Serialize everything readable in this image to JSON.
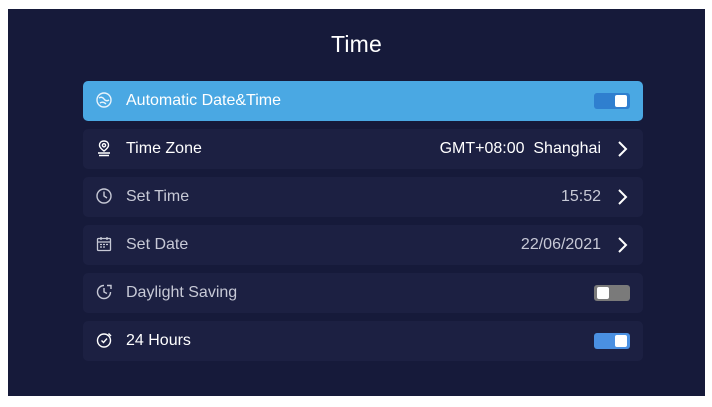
{
  "page": {
    "title": "Time"
  },
  "settings": [
    {
      "label": "Automatic Date&Time",
      "icon": "globe-clock-icon",
      "control": "toggle",
      "state": "on",
      "selected": true
    },
    {
      "label": "Time Zone",
      "icon": "location-pin-icon",
      "control": "chevron",
      "value": "GMT+08:00  Shanghai"
    },
    {
      "label": "Set Time",
      "icon": "clock-icon",
      "control": "chevron",
      "value": "15:52"
    },
    {
      "label": "Set Date",
      "icon": "calendar-icon",
      "control": "chevron",
      "value": "22/06/2021"
    },
    {
      "label": "Daylight Saving",
      "icon": "daylight-clock-icon",
      "control": "toggle",
      "state": "off"
    },
    {
      "label": "24 Hours",
      "icon": "timer-clock-icon",
      "control": "toggle",
      "state": "on"
    }
  ],
  "colors": {
    "background": "#161a3a",
    "row": "#1c2042",
    "selected_row": "#4aa8e3",
    "toggle_on": "#4a90e2",
    "toggle_off": "#7a7a7a"
  }
}
